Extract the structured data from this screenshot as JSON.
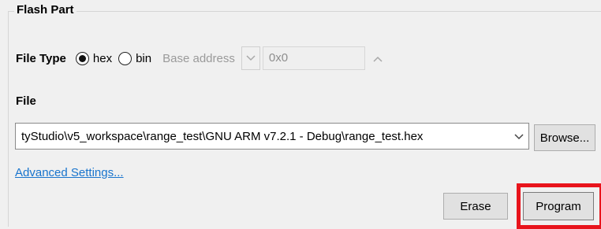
{
  "group": {
    "title": "Flash Part"
  },
  "file_type": {
    "label": "File Type",
    "options": [
      {
        "label": "hex",
        "selected": true
      },
      {
        "label": "bin",
        "selected": false
      }
    ],
    "base_address_label": "Base address",
    "base_address_value": "0x0"
  },
  "file": {
    "label": "File",
    "path": "tyStudio\\v5_workspace\\range_test\\GNU ARM v7.2.1 - Debug\\range_test.hex",
    "browse_label": "Browse..."
  },
  "advanced_link": "Advanced Settings...",
  "actions": {
    "erase_label": "Erase",
    "program_label": "Program"
  },
  "colors": {
    "highlight": "#e8141c",
    "link": "#1874cd"
  },
  "icons": {
    "combo_arrow": "chevron-down-icon",
    "spinner_up": "chevron-up-icon"
  }
}
